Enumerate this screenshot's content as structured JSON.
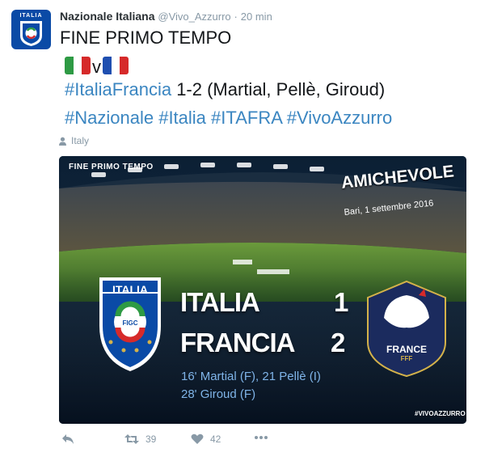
{
  "tweet": {
    "author_name": "Nazionale Italiana",
    "handle": "@Vivo_Azzurro",
    "separator": "·",
    "time": "20 min",
    "avatar_text": "ITALIA",
    "title": "FINE PRIMO TEMPO",
    "versus": "v",
    "line1": {
      "hashtag": "#ItaliaFrancia",
      "text": " 1-2 (Martial, Pellè, Giroud)"
    },
    "line2": {
      "tags": [
        "#Nazionale",
        "#Italia",
        "#ITAFRA",
        "#VivoAzzurro"
      ]
    },
    "location": "Italy"
  },
  "card": {
    "top_left": "FINE PRIMO TEMPO",
    "event": "AMICHEVOLE",
    "venue": "Bari, 1 settembre 2016",
    "team1": "ITALIA",
    "score1": "1",
    "team2": "FRANCIA",
    "score2": "2",
    "scorers1": "16' Martial (F), 21 Pellè (I)",
    "scorers2": "28' Giroud (F)",
    "crest_italy_text": "ITALIA",
    "crest_italy_mark": "FIGC",
    "crest_france_text": "FRANCE",
    "crest_france_sub": "FFF",
    "hashtag": "#VIVOAZZURRO"
  },
  "actions": {
    "retweets": "39",
    "likes": "42"
  },
  "colors": {
    "link": "#3b86c1",
    "muted": "#8899a6",
    "italy_blue": "#0a4aa6",
    "france_navy": "#1b2b5e"
  },
  "icons": [
    "reply-icon",
    "retweet-icon",
    "heart-icon",
    "more-icon",
    "location-icon"
  ]
}
